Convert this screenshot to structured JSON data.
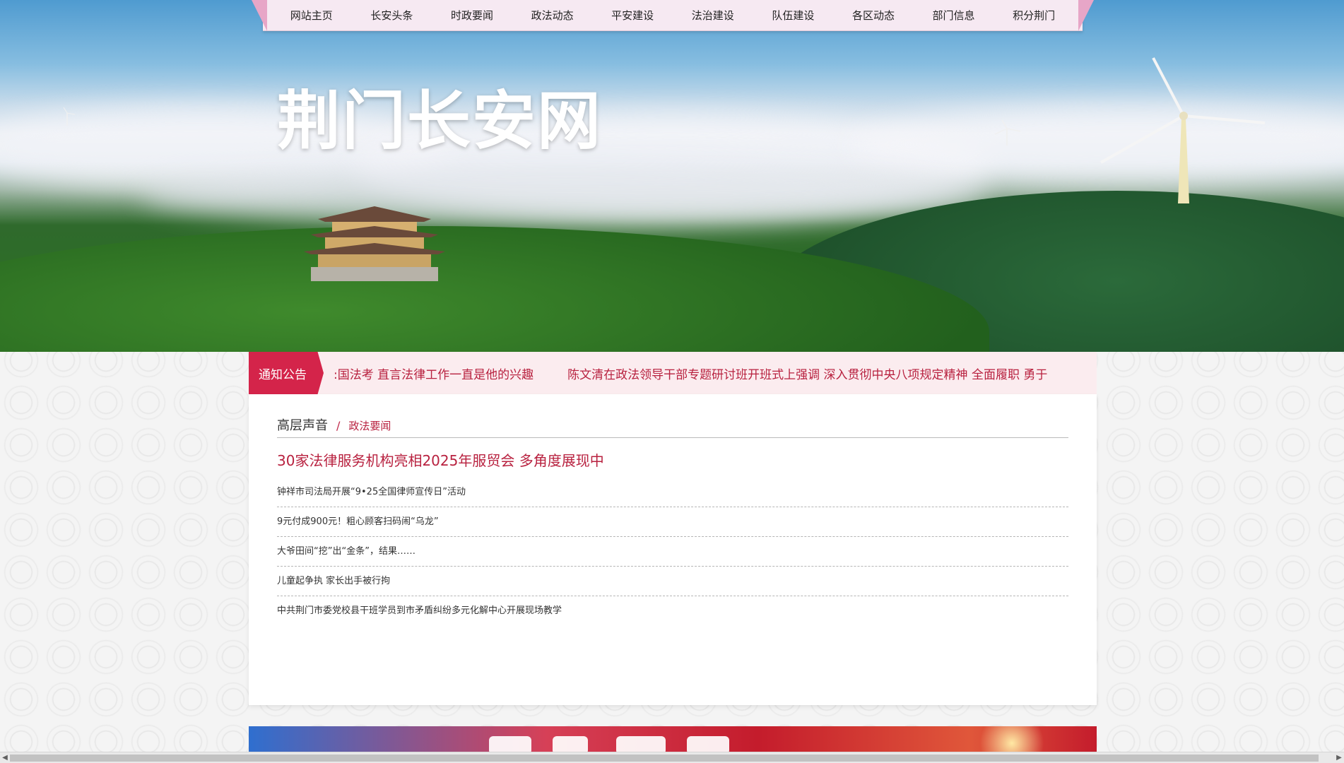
{
  "site": {
    "title": "荆门长安网"
  },
  "nav": {
    "items": [
      "网站主页",
      "长安头条",
      "时政要闻",
      "政法动态",
      "平安建设",
      "法治建设",
      "队伍建设",
      "各区动态",
      "部门信息",
      "积分荆门"
    ]
  },
  "notice": {
    "tag": "通知公告",
    "items": [
      ":国法考 直言法律工作一直是他的兴趣",
      "陈文清在政法领导干部专题研讨班开班式上强调 深入贯彻中央八项规定精神 全面履职 勇于"
    ]
  },
  "news": {
    "breadcrumb": {
      "primary": "高层声音",
      "separator": "/",
      "secondary": "政法要闻"
    },
    "headline": "30家法律服务机构亮相2025年服贸会 多角度展现中",
    "items": [
      "钟祥市司法局开展“9•25全国律师宣传日”活动",
      "9元付成900元！粗心顾客扫码闹“乌龙”",
      "大爷田间“挖”出“金条”，结果……",
      "儿童起争执 家长出手被行拘",
      "中共荆门市委党校县干班学员到市矛盾纠纷多元化解中心开展现场教学"
    ]
  },
  "scrollbar": {
    "left_arrow": "◀",
    "right_arrow": "▶"
  },
  "colors": {
    "accent": "#b8213f",
    "tag": "#d4244a",
    "nav_bg": "#f6e9f2",
    "notice_bg": "#fbecef"
  }
}
